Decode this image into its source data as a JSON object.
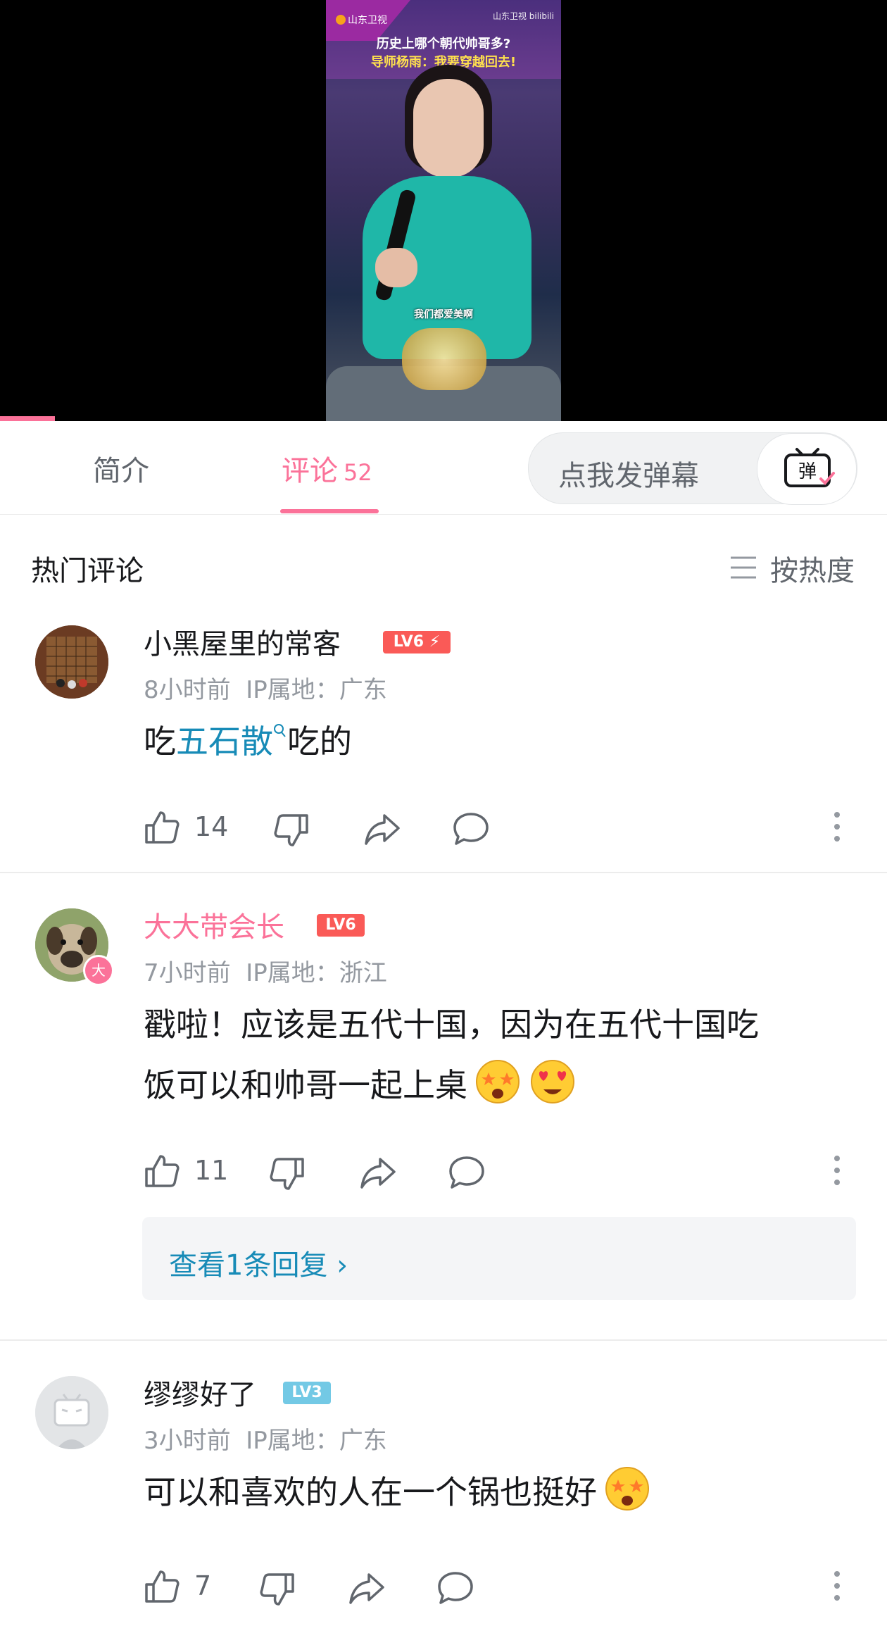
{
  "video": {
    "channel_logo_text": "山东卫视",
    "watermark_text": "山东卫视 bilibili",
    "caption_line1": "历史上哪个朝代帅哥多?",
    "caption_line2": "导师杨雨：我要穿越回去!",
    "subtitle": "我们都爱美啊",
    "progress_fraction": 0.062
  },
  "tabs": {
    "intro_label": "简介",
    "comments_label": "评论",
    "comments_count": "52",
    "danmaku_placeholder": "点我发弹幕",
    "danmaku_icon_char": "弹"
  },
  "section": {
    "title": "热门评论",
    "sort_label": "按热度"
  },
  "colors": {
    "accent": "#fb7299",
    "link": "#178bb7",
    "vip_name": "#fb7299",
    "level_lv6": "#fa5a57",
    "level_lv3": "#73c9e5"
  },
  "comments": [
    {
      "username": "小黑屋里的常客",
      "level": "LV6",
      "time": "8小时前",
      "ip": "IP属地：广东",
      "text_before": "吃",
      "text_link": "五石散",
      "text_after": "吃的",
      "likes": "14"
    },
    {
      "username": "大大带会长",
      "level": "LV6",
      "badge": "大",
      "time": "7小时前",
      "ip": "IP属地：浙江",
      "text_line1": "戳啦！应该是五代十国，因为在五代十国吃",
      "text_line2": "饭可以和帅哥一起上桌",
      "likes": "11",
      "reply_link": "查看1条回复 ›"
    },
    {
      "username": "缪缪好了",
      "level": "LV3",
      "time": "3小时前",
      "ip": "IP属地：广东",
      "text": "可以和喜欢的人在一个锅也挺好",
      "likes": "7"
    }
  ]
}
